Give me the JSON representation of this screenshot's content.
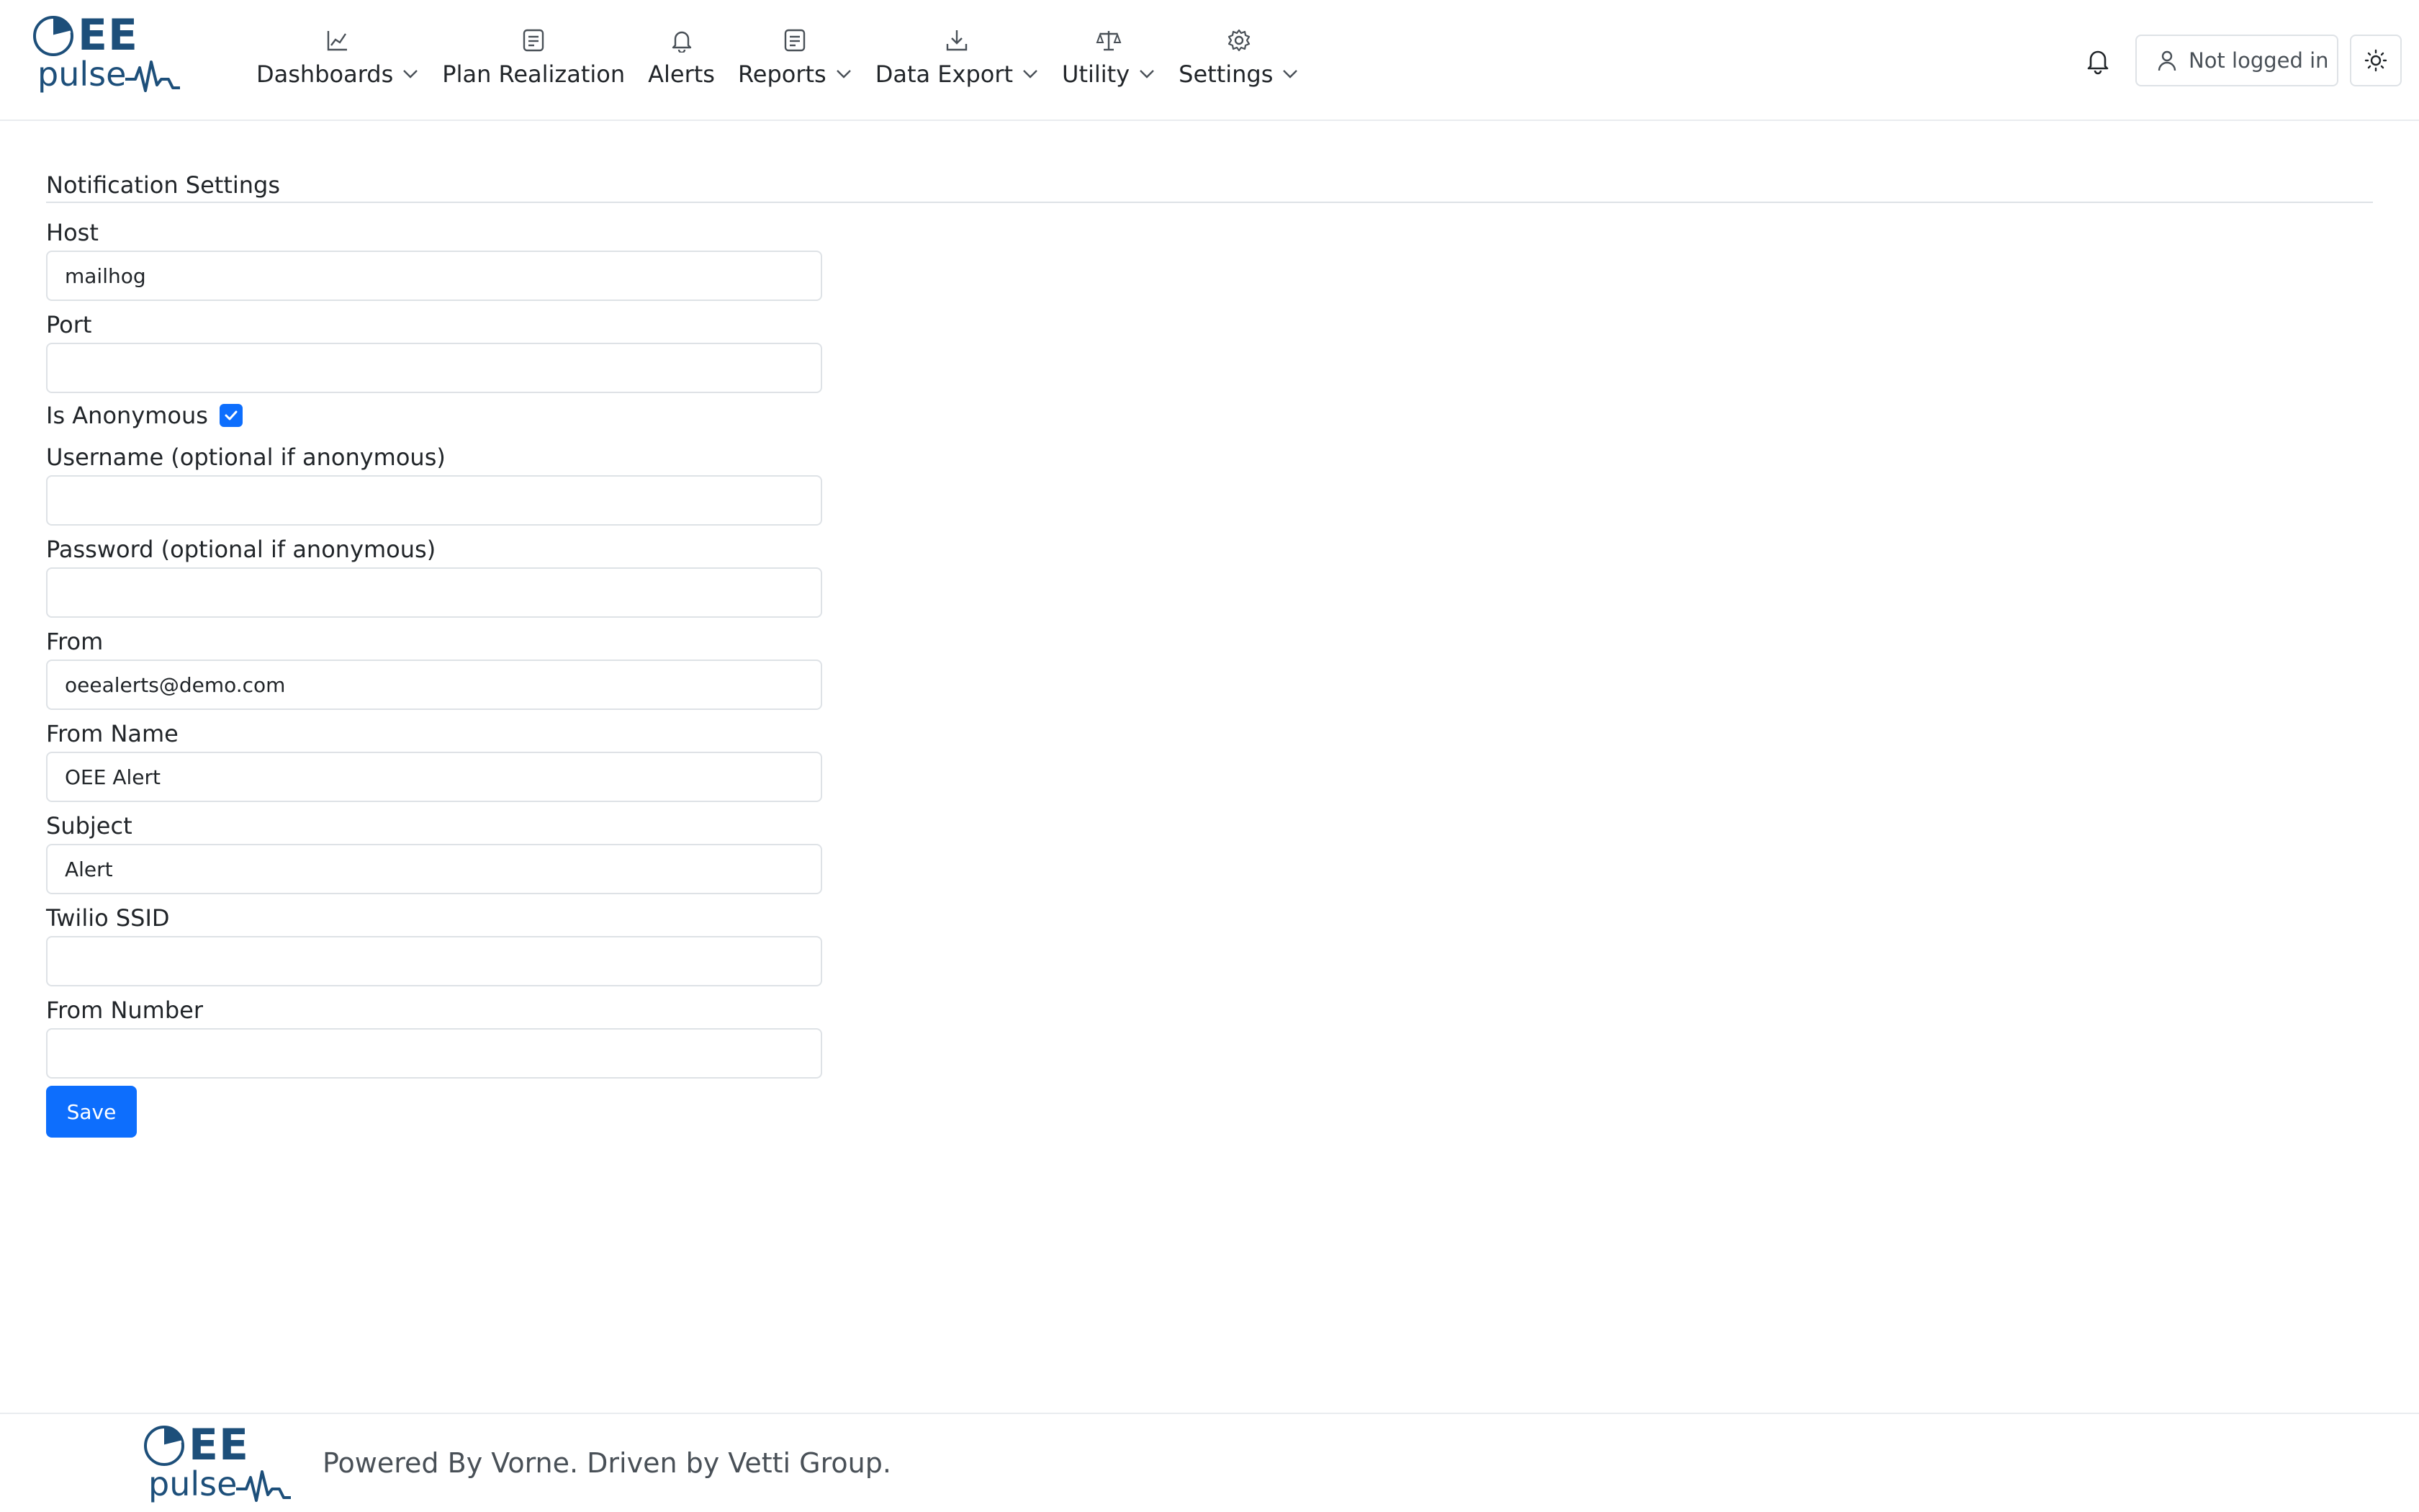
{
  "brand": {
    "logo_top": "EE",
    "logo_bottom": "pulse",
    "primary_color": "#1d4f7a",
    "accent_color": "#0d6efd"
  },
  "nav": [
    {
      "label": "Dashboards",
      "icon": "chart-line-icon",
      "dropdown": true
    },
    {
      "label": "Plan Realization",
      "icon": "document-icon",
      "dropdown": false
    },
    {
      "label": "Alerts",
      "icon": "bell-icon",
      "dropdown": false
    },
    {
      "label": "Reports",
      "icon": "document-icon",
      "dropdown": true
    },
    {
      "label": "Data Export",
      "icon": "download-icon",
      "dropdown": true
    },
    {
      "label": "Utility",
      "icon": "balance-scale-icon",
      "dropdown": true
    },
    {
      "label": "Settings",
      "icon": "gear-icon",
      "dropdown": true
    }
  ],
  "header": {
    "user_label": "Not logged in"
  },
  "form": {
    "title": "Notification Settings",
    "host": {
      "label": "Host",
      "value": "mailhog"
    },
    "port": {
      "label": "Port",
      "value": ""
    },
    "anonymous": {
      "label": "Is Anonymous",
      "checked": true
    },
    "username": {
      "label": "Username (optional if anonymous)",
      "value": ""
    },
    "password": {
      "label": "Password (optional if anonymous)",
      "value": ""
    },
    "from": {
      "label": "From",
      "value": "oeealerts@demo.com"
    },
    "from_name": {
      "label": "From Name",
      "value": "OEE Alert"
    },
    "subject": {
      "label": "Subject",
      "value": "Alert"
    },
    "twilio_ssid": {
      "label": "Twilio SSID",
      "value": ""
    },
    "from_number": {
      "label": "From Number",
      "value": ""
    },
    "save_label": "Save"
  },
  "footer": {
    "text": "Powered By Vorne. Driven by Vetti Group."
  }
}
